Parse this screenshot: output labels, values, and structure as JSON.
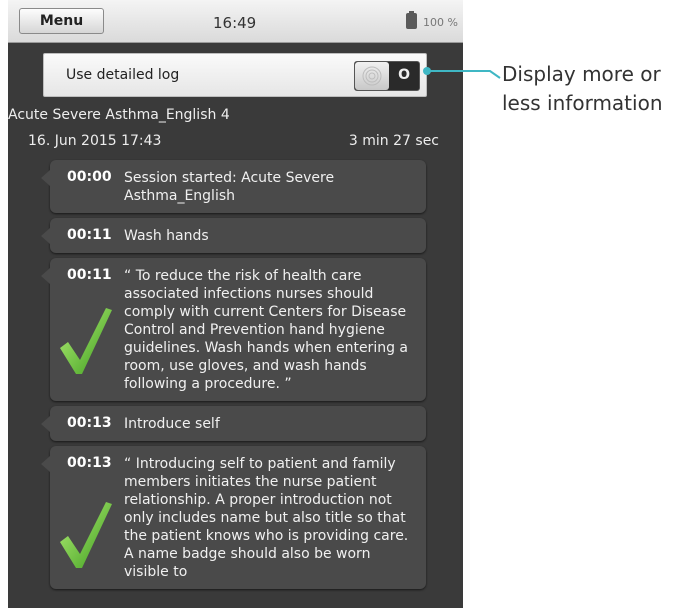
{
  "statusbar": {
    "menu_label": "Menu",
    "time": "16:49",
    "battery_label": "100 %"
  },
  "settings": {
    "detailed_log_label": "Use detailed log",
    "toggle_state_label": "O"
  },
  "session": {
    "title": "Acute Severe Asthma_English 4",
    "date": "16. Jun 2015 17:43",
    "duration": "3 min 27 sec"
  },
  "log": {
    "entries": [
      {
        "time": "00:00",
        "text": "Session started: Acute Severe Asthma_English",
        "check": false
      },
      {
        "time": "00:11",
        "text": "Wash hands",
        "check": false
      },
      {
        "time": "00:11",
        "text": "“ To reduce the risk of health care associated infections nurses should comply with current Centers for Disease Control and Prevention hand hygiene guidelines. Wash hands when entering a room, use gloves, and wash hands following a procedure. ”",
        "check": true
      },
      {
        "time": "00:13",
        "text": "Introduce self",
        "check": false
      },
      {
        "time": "00:13",
        "text": "“ Introducing self to patient and family members initiates the nurse patient relationship. A proper introduction not only includes name but also title so that the patient knows who is providing care. A name badge should also be worn visible to",
        "check": true
      }
    ]
  },
  "annotation": {
    "text": "Display more or less information",
    "color": "#3fb7c4"
  },
  "icons": [
    "battery-icon",
    "toggle-icon",
    "checkmark-icon"
  ]
}
